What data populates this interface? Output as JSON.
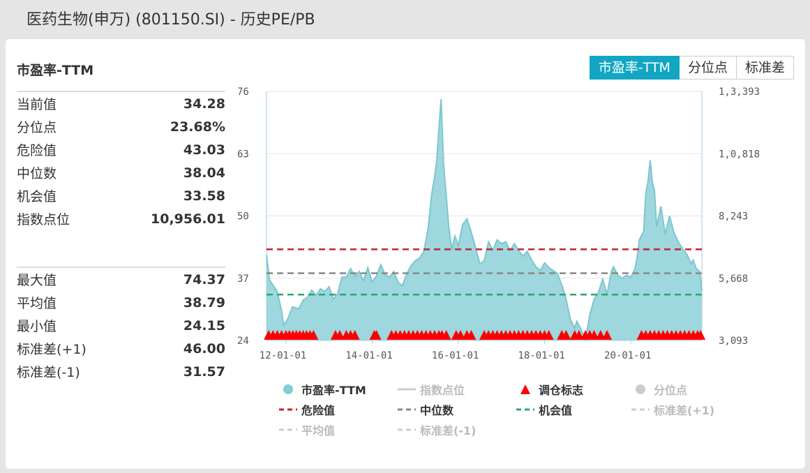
{
  "header": {
    "title": "医药生物(申万) (801150.SI) - 历史PE/PB"
  },
  "panel": {
    "title": "市盈率-TTM"
  },
  "tabs": [
    {
      "label": "市盈率-TTM",
      "active": true
    },
    {
      "label": "分位点",
      "active": false
    },
    {
      "label": "标准差",
      "active": false
    }
  ],
  "stats_top": [
    {
      "label": "当前值",
      "value": "34.28"
    },
    {
      "label": "分位点",
      "value": "23.68%"
    },
    {
      "label": "危险值",
      "value": "43.03"
    },
    {
      "label": "中位数",
      "value": "38.04"
    },
    {
      "label": "机会值",
      "value": "33.58"
    },
    {
      "label": "指数点位",
      "value": "10,956.01"
    }
  ],
  "stats_bottom": [
    {
      "label": "最大值",
      "value": "74.37"
    },
    {
      "label": "平均值",
      "value": "38.79"
    },
    {
      "label": "最小值",
      "value": "24.15"
    },
    {
      "label": "标准差(+1)",
      "value": "46.00"
    },
    {
      "label": "标准差(-1)",
      "value": "31.57"
    }
  ],
  "legend": [
    {
      "label": "市盈率-TTM",
      "symbol": "circle",
      "color": "#7ecfd6",
      "active": true
    },
    {
      "label": "指数点位",
      "symbol": "line",
      "color": "#cccccc",
      "active": false
    },
    {
      "label": "调仓标志",
      "symbol": "triangle",
      "color": "#ff0000",
      "active": true
    },
    {
      "label": "分位点",
      "symbol": "circle",
      "color": "#cccccc",
      "active": false
    },
    {
      "label": "危险值",
      "symbol": "dash",
      "color": "#c0262b",
      "active": true
    },
    {
      "label": "中位数",
      "symbol": "dash",
      "color": "#888888",
      "active": true
    },
    {
      "label": "机会值",
      "symbol": "dash",
      "color": "#2aa56e",
      "active": true
    },
    {
      "label": "标准差(+1)",
      "symbol": "dash",
      "color": "#cccccc",
      "active": false
    },
    {
      "label": "平均值",
      "symbol": "dash",
      "color": "#cccccc",
      "active": false
    },
    {
      "label": "标准差(-1)",
      "symbol": "dash",
      "color": "#cccccc",
      "active": false
    }
  ],
  "chart_data": {
    "type": "area",
    "y_left_ticks": [
      "76",
      "63",
      "50",
      "37",
      "24"
    ],
    "y_right_ticks": [
      "1,3,393",
      "1,0,818",
      "8,243",
      "5,668",
      "3,093"
    ],
    "x_ticks": [
      "12-01-01",
      "14-01-01",
      "16-01-01",
      "18-01-01",
      "20-01-01"
    ],
    "ylim": [
      24,
      76
    ],
    "xlim": [
      2011.55,
      2021.65
    ],
    "x_tick_values": [
      2012.0,
      2014.0,
      2016.0,
      2018.0,
      2020.0
    ],
    "series": [
      {
        "name": "市盈率-TTM",
        "color": "#8fd3da",
        "points": [
          [
            2011.55,
            41.8
          ],
          [
            2011.62,
            36.6
          ],
          [
            2011.7,
            35.6
          ],
          [
            2011.8,
            34.2
          ],
          [
            2011.9,
            30.2
          ],
          [
            2011.95,
            27.2
          ],
          [
            2012.05,
            28.6
          ],
          [
            2012.15,
            31.0
          ],
          [
            2012.3,
            30.6
          ],
          [
            2012.4,
            32.4
          ],
          [
            2012.5,
            33.0
          ],
          [
            2012.6,
            34.5
          ],
          [
            2012.7,
            33.4
          ],
          [
            2012.8,
            34.8
          ],
          [
            2012.9,
            34.2
          ],
          [
            2013.0,
            35.2
          ],
          [
            2013.1,
            32.6
          ],
          [
            2013.2,
            33.8
          ],
          [
            2013.3,
            37.2
          ],
          [
            2013.4,
            37.2
          ],
          [
            2013.5,
            39.0
          ],
          [
            2013.6,
            37.4
          ],
          [
            2013.7,
            38.4
          ],
          [
            2013.8,
            36.4
          ],
          [
            2013.9,
            39.2
          ],
          [
            2014.0,
            36.2
          ],
          [
            2014.1,
            37.4
          ],
          [
            2014.2,
            39.8
          ],
          [
            2014.3,
            37.8
          ],
          [
            2014.4,
            37.2
          ],
          [
            2014.5,
            38.4
          ],
          [
            2014.6,
            36.2
          ],
          [
            2014.7,
            35.4
          ],
          [
            2014.8,
            37.8
          ],
          [
            2014.9,
            39.6
          ],
          [
            2015.0,
            40.6
          ],
          [
            2015.1,
            41.2
          ],
          [
            2015.2,
            42.6
          ],
          [
            2015.3,
            47.4
          ],
          [
            2015.38,
            54.4
          ],
          [
            2015.45,
            58.2
          ],
          [
            2015.5,
            61.6
          ],
          [
            2015.55,
            68.2
          ],
          [
            2015.6,
            74.4
          ],
          [
            2015.66,
            60.6
          ],
          [
            2015.72,
            54.2
          ],
          [
            2015.78,
            47.6
          ],
          [
            2015.85,
            43.0
          ],
          [
            2015.92,
            45.8
          ],
          [
            2016.0,
            43.8
          ],
          [
            2016.1,
            48.2
          ],
          [
            2016.2,
            49.4
          ],
          [
            2016.3,
            46.6
          ],
          [
            2016.4,
            43.4
          ],
          [
            2016.5,
            40.0
          ],
          [
            2016.6,
            40.6
          ],
          [
            2016.7,
            44.6
          ],
          [
            2016.8,
            42.8
          ],
          [
            2016.9,
            45.0
          ],
          [
            2017.0,
            44.2
          ],
          [
            2017.1,
            44.6
          ],
          [
            2017.2,
            42.8
          ],
          [
            2017.3,
            44.2
          ],
          [
            2017.4,
            42.8
          ],
          [
            2017.5,
            41.6
          ],
          [
            2017.6,
            42.6
          ],
          [
            2017.7,
            40.8
          ],
          [
            2017.8,
            39.4
          ],
          [
            2017.9,
            38.6
          ],
          [
            2018.0,
            40.2
          ],
          [
            2018.1,
            39.2
          ],
          [
            2018.2,
            38.6
          ],
          [
            2018.3,
            38.0
          ],
          [
            2018.4,
            35.6
          ],
          [
            2018.5,
            32.6
          ],
          [
            2018.6,
            28.4
          ],
          [
            2018.7,
            26.6
          ],
          [
            2018.75,
            28.0
          ],
          [
            2018.85,
            26.2
          ],
          [
            2018.95,
            24.2
          ],
          [
            2019.05,
            29.4
          ],
          [
            2019.15,
            32.6
          ],
          [
            2019.25,
            34.0
          ],
          [
            2019.35,
            36.8
          ],
          [
            2019.45,
            33.6
          ],
          [
            2019.55,
            38.4
          ],
          [
            2019.6,
            39.4
          ],
          [
            2019.7,
            37.6
          ],
          [
            2019.8,
            37.0
          ],
          [
            2019.9,
            37.6
          ],
          [
            2020.0,
            37.2
          ],
          [
            2020.1,
            39.0
          ],
          [
            2020.15,
            41.4
          ],
          [
            2020.2,
            45.0
          ],
          [
            2020.3,
            46.8
          ],
          [
            2020.35,
            54.8
          ],
          [
            2020.4,
            57.2
          ],
          [
            2020.45,
            61.6
          ],
          [
            2020.5,
            57.0
          ],
          [
            2020.55,
            55.4
          ],
          [
            2020.6,
            47.8
          ],
          [
            2020.7,
            52.0
          ],
          [
            2020.8,
            46.2
          ],
          [
            2020.9,
            50.0
          ],
          [
            2021.0,
            46.6
          ],
          [
            2021.1,
            44.6
          ],
          [
            2021.2,
            43.2
          ],
          [
            2021.3,
            42.0
          ],
          [
            2021.4,
            40.0
          ],
          [
            2021.45,
            40.8
          ],
          [
            2021.52,
            39.0
          ],
          [
            2021.6,
            38.4
          ],
          [
            2021.65,
            34.3
          ]
        ]
      }
    ],
    "ref_lines": [
      {
        "name": "危险值",
        "y": 43.03,
        "color": "#c0262b"
      },
      {
        "name": "中位数",
        "y": 38.04,
        "color": "#888888"
      },
      {
        "name": "机会值",
        "y": 33.58,
        "color": "#2aa56e"
      }
    ],
    "markers": {
      "name": "调仓标志",
      "color": "#ff0000",
      "x": [
        2011.6,
        2011.7,
        2011.8,
        2011.9,
        2012.0,
        2012.08,
        2012.16,
        2012.24,
        2012.32,
        2012.4,
        2012.48,
        2012.56,
        2012.64,
        2013.15,
        2013.25,
        2013.4,
        2013.5,
        2013.6,
        2014.05,
        2014.1,
        2014.45,
        2014.55,
        2014.65,
        2014.75,
        2014.85,
        2014.95,
        2015.05,
        2015.15,
        2015.25,
        2015.35,
        2015.45,
        2015.55,
        2015.62,
        2015.72,
        2015.95,
        2016.05,
        2016.2,
        2016.3,
        2016.6,
        2016.7,
        2016.8,
        2016.9,
        2017.0,
        2017.1,
        2017.2,
        2017.3,
        2017.4,
        2017.5,
        2017.6,
        2017.7,
        2017.8,
        2017.9,
        2018.0,
        2018.1,
        2018.4,
        2018.5,
        2018.7,
        2018.8,
        2018.95,
        2019.05,
        2019.15,
        2019.3,
        2019.45,
        2020.25,
        2020.35,
        2020.45,
        2020.55,
        2020.65,
        2020.75,
        2020.85,
        2020.95,
        2021.05,
        2021.15,
        2021.25,
        2021.35,
        2021.45,
        2021.55,
        2021.62
      ]
    },
    "grid": true
  }
}
